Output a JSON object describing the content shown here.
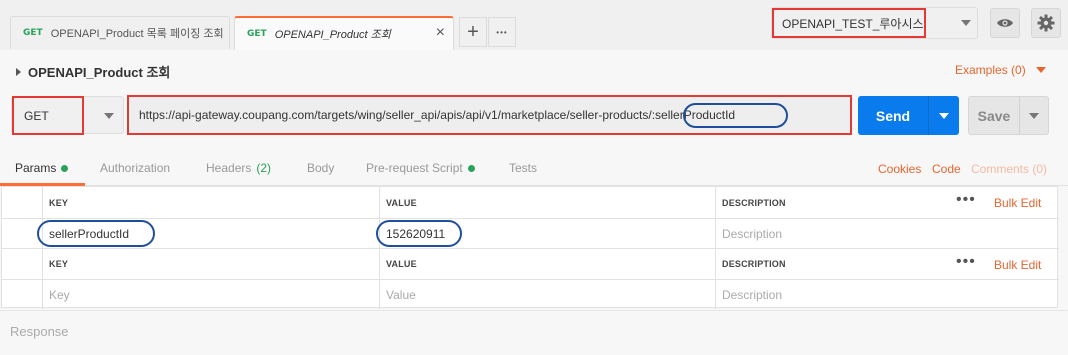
{
  "tabs": [
    {
      "method": "GET",
      "title": "OPENAPI_Product 목록 페이징 조회",
      "active": false
    },
    {
      "method": "GET",
      "title": "OPENAPI_Product 조회",
      "active": true
    }
  ],
  "tabbar": {
    "close": "×",
    "add": "+",
    "more": "•••"
  },
  "environment": {
    "selected": "OPENAPI_TEST_루아시스"
  },
  "request": {
    "name": "OPENAPI_Product 조회",
    "examples_label": "Examples (0)",
    "method": "GET",
    "url": "https://api-gateway.coupang.com/targets/wing/seller_api/apis/api/v1/marketplace/seller-products/:sellerProductId",
    "send_label": "Send",
    "save_label": "Save"
  },
  "subtabs": {
    "params": "Params",
    "authorization": "Authorization",
    "headers": "Headers",
    "headers_count": "(2)",
    "body": "Body",
    "prerequest": "Pre-request Script",
    "tests": "Tests",
    "cookies": "Cookies",
    "code": "Code",
    "comments": "Comments (0)"
  },
  "path_variables": {
    "columns": [
      "KEY",
      "VALUE",
      "DESCRIPTION"
    ],
    "bulk_edit": "Bulk Edit",
    "rows": [
      {
        "key": "sellerProductId",
        "value": "152620911",
        "description_placeholder": "Description"
      }
    ]
  },
  "query_params": {
    "columns": [
      "KEY",
      "VALUE",
      "DESCRIPTION"
    ],
    "bulk_edit": "Bulk Edit",
    "placeholder": {
      "key": "Key",
      "value": "Value",
      "description": "Description"
    }
  },
  "response": {
    "label": "Response"
  },
  "colors": {
    "accent": "#ff6c37",
    "send": "#097bed",
    "get": "#2aa35a",
    "highlight_box": "#e53935",
    "highlight_oval": "#1f4f9c"
  }
}
